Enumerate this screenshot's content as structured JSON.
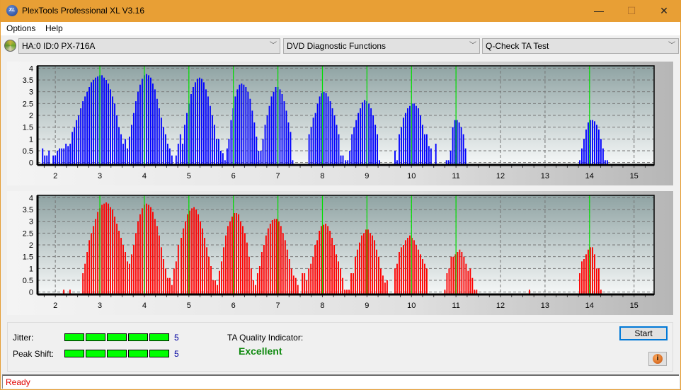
{
  "window": {
    "title": "PlexTools Professional XL V3.16",
    "logo_text": "XL",
    "controls": {
      "minimize": "—",
      "maximize": "☐",
      "close": "✕"
    }
  },
  "menu": {
    "items": [
      "Options",
      "Help"
    ]
  },
  "toolbar": {
    "drive": "HA:0 ID:0  PX-716A",
    "function_group": "DVD Diagnostic Functions",
    "test": "Q-Check TA Test",
    "chevron": "﹀"
  },
  "colors": {
    "blue_series": "#0000ff",
    "red_series": "#ff0000",
    "marker_line": "#00e000",
    "meter_fill": "#00ff00",
    "quality_text": "#108a10",
    "status_text": "#e00000"
  },
  "chart_data": [
    {
      "type": "bar",
      "title": "",
      "series_name": "TA land/pit distribution (top)",
      "color": "#0000ff",
      "xlabel": "",
      "ylabel": "",
      "xlim": [
        1.6,
        15.45
      ],
      "ylim": [
        -0.1,
        4.1
      ],
      "x_ticks": [
        2,
        3,
        4,
        5,
        6,
        7,
        8,
        9,
        10,
        11,
        12,
        13,
        14,
        15
      ],
      "y_ticks": [
        0,
        0.5,
        1,
        1.5,
        2,
        2.5,
        3,
        3.5,
        4
      ],
      "y_tick_labels": [
        "0",
        "0.5",
        "1",
        "1.5",
        "2",
        "2.5",
        "3",
        "3.5",
        "4"
      ],
      "reference_lines": [
        3,
        4,
        5,
        6,
        7,
        8,
        9,
        10,
        11,
        14
      ],
      "grid": true,
      "bar_step": 0.0476,
      "clusters": [
        {
          "start": 1.62,
          "values": [
            0,
            0,
            0.6,
            0.3,
            0.3,
            0.5,
            0,
            0.3,
            0.3,
            0.5,
            0.6,
            0.6,
            0.6,
            0.8,
            0.7,
            0.8,
            1.3,
            1.5,
            1.8,
            2.0,
            2.3,
            2.6,
            2.8,
            3.0,
            3.2,
            3.4,
            3.5,
            3.6,
            3.65,
            3.7,
            3.7,
            3.6,
            3.5,
            3.35,
            3.1,
            2.8,
            2.5,
            2.0,
            1.5,
            1.2,
            0.8,
            1.0,
            0.6,
            1.1,
            1.6,
            2.1,
            2.6,
            3.0,
            3.3,
            3.55,
            3.7,
            3.75,
            3.7,
            3.6,
            3.35,
            3.1,
            2.7,
            2.3,
            1.9,
            1.5,
            1.2,
            0.8,
            0.6,
            0.3,
            0,
            0.3,
            0.8,
            1.2
          ]
        },
        {
          "start": 4.86,
          "values": [
            0.8,
            1.6,
            2.1,
            2.5,
            2.9,
            3.2,
            3.4,
            3.55,
            3.6,
            3.55,
            3.4,
            3.1,
            2.8,
            2.4,
            2.0,
            1.6,
            1.0,
            1.0,
            0.5,
            0.4,
            0.1,
            0.6
          ]
        },
        {
          "start": 5.9,
          "values": [
            1.0,
            1.8,
            2.3,
            2.8,
            3.1,
            3.3,
            3.35,
            3.3,
            3.2,
            3.0,
            2.7,
            2.2,
            1.7,
            1.1,
            0.5
          ]
        },
        {
          "start": 6.57,
          "values": [
            0.1,
            0.5,
            1.0,
            1.6,
            2.0,
            2.4,
            2.8,
            3.0,
            3.2,
            3.2,
            3.1,
            2.9,
            2.6,
            2.2,
            1.7,
            1.3,
            0.1
          ]
        },
        {
          "start": 7.7,
          "values": [
            1.2,
            1.5,
            1.9,
            2.1,
            2.5,
            2.8,
            2.95,
            3.0,
            2.95,
            2.8,
            2.6,
            2.3,
            2.0,
            1.6,
            1.2,
            0.3,
            0.3
          ]
        },
        {
          "start": 8.52,
          "values": [
            0.1,
            0.1,
            0.5,
            1.2,
            1.5,
            1.8,
            2.1,
            2.3,
            2.55,
            2.65,
            2.6,
            2.5,
            2.3,
            2.0,
            1.6,
            1.2,
            0.1
          ]
        },
        {
          "start": 9.63,
          "values": [
            0.5,
            0.1,
            1.2,
            1.5,
            1.9,
            2.1,
            2.3,
            2.4,
            2.5,
            2.5,
            2.4,
            2.3,
            2.0,
            1.6,
            1.2,
            1.2,
            0.7,
            0.6
          ]
        },
        {
          "start": 10.5,
          "values": [
            0,
            0.8,
            0,
            0,
            0,
            0,
            0.1,
            0.1,
            0.5,
            1.5,
            1.8,
            1.8,
            1.7,
            1.5,
            1.2,
            0.6
          ]
        },
        {
          "start": 13.78,
          "values": [
            0.1,
            0.6,
            1.0,
            1.4,
            1.7,
            1.8,
            1.8,
            1.75,
            1.6,
            1.4,
            1.0,
            0.6,
            0.1,
            0.1
          ]
        }
      ]
    },
    {
      "type": "bar",
      "title": "",
      "series_name": "TA land/pit distribution (bottom)",
      "color": "#ff0000",
      "xlabel": "",
      "ylabel": "",
      "xlim": [
        1.6,
        15.45
      ],
      "ylim": [
        -0.1,
        4.1
      ],
      "x_ticks": [
        2,
        3,
        4,
        5,
        6,
        7,
        8,
        9,
        10,
        11,
        12,
        13,
        14,
        15
      ],
      "y_ticks": [
        0,
        0.5,
        1,
        1.5,
        2,
        2.5,
        3,
        3.5,
        4
      ],
      "y_tick_labels": [
        "0",
        "0.5",
        "1",
        "1.5",
        "2",
        "2.5",
        "3",
        "3.5",
        "4"
      ],
      "reference_lines": [
        3,
        4,
        5,
        6,
        7,
        8,
        9,
        10,
        11,
        14
      ],
      "grid": true,
      "bar_step": 0.0476,
      "clusters": [
        {
          "start": 2.19,
          "values": [
            0.1
          ]
        },
        {
          "start": 2.33,
          "values": [
            0.1
          ]
        },
        {
          "start": 2.62,
          "values": [
            0.8,
            1.2,
            1.7,
            2.2,
            2.5,
            2.8,
            3.1,
            3.4,
            3.55,
            3.7,
            3.75,
            3.8,
            3.75,
            3.6,
            3.5,
            3.2,
            2.9,
            2.6,
            2.3,
            2.0,
            1.7,
            1.3,
            1.2,
            1.6,
            2.0,
            2.5,
            3.0,
            3.3,
            3.55,
            3.7,
            3.75,
            3.7,
            3.6,
            3.4,
            3.1,
            2.8,
            2.4,
            1.9,
            1.4,
            1.0,
            0.6,
            0.6,
            0.3,
            1.0,
            1.3,
            2.0
          ]
        },
        {
          "start": 4.83,
          "values": [
            2.3,
            2.7,
            3.0,
            3.3,
            3.45,
            3.55,
            3.6,
            3.5,
            3.3,
            3.0,
            2.7,
            2.3,
            1.9,
            1.5,
            1.1,
            0.5,
            0.5,
            0.3,
            0.9,
            1.3,
            1.9,
            2.4,
            2.8,
            3.0,
            3.2,
            3.35,
            3.35,
            3.3,
            3.0,
            2.8,
            2.5,
            2.1,
            1.5,
            1.0,
            0.5,
            0.3,
            0.8,
            1.1,
            1.7,
            2.0,
            2.4,
            2.7,
            2.9,
            3.05,
            3.1,
            3.1,
            3.0,
            2.8,
            2.5,
            2.2,
            1.8,
            1.4,
            1.0,
            0.7,
            0.6,
            0.3
          ]
        },
        {
          "start": 7.55,
          "values": [
            0.8,
            0.8,
            0.5,
            1.0,
            1.2,
            1.5,
            2.0,
            2.2,
            2.6,
            2.8,
            2.85,
            2.9,
            2.8,
            2.6,
            2.3,
            2.0,
            1.6,
            1.3,
            1.0,
            0.6,
            0.1,
            0.1,
            0.1,
            0.8,
            0.8,
            1.5,
            1.8,
            2.1,
            2.4,
            2.5,
            2.65,
            2.65,
            2.5,
            2.4,
            2.2,
            1.8,
            1.5,
            1.0,
            0.7,
            0.4,
            0.5
          ]
        },
        {
          "start": 9.63,
          "values": [
            1.0,
            1.2,
            1.7,
            1.9,
            2.0,
            2.2,
            2.3,
            2.4,
            2.3,
            2.2,
            2.0,
            1.8,
            1.6,
            1.4,
            1.2,
            1.0
          ]
        },
        {
          "start": 10.75,
          "values": [
            0.1,
            0.8,
            1.0,
            1.5,
            1.5,
            1.6,
            1.7,
            1.8,
            1.7,
            1.5,
            1.2,
            0.9,
            1.0,
            0.6,
            0.1,
            0.1
          ]
        },
        {
          "start": 12.65,
          "values": [
            0.1
          ]
        },
        {
          "start": 13.78,
          "values": [
            0.8,
            1.3,
            1.4,
            1.6,
            1.8,
            1.9,
            1.9,
            1.6,
            1.0,
            1.0,
            0.1
          ]
        }
      ]
    }
  ],
  "results": {
    "jitter_label": "Jitter:",
    "jitter_value": "5",
    "jitter_level": 5,
    "jitter_max": 5,
    "peak_shift_label": "Peak Shift:",
    "peak_shift_value": "5",
    "peak_shift_level": 5,
    "peak_shift_max": 5,
    "ta_quality_label": "TA Quality Indicator:",
    "ta_quality_value": "Excellent"
  },
  "buttons": {
    "start": "Start",
    "info_icon": "i"
  },
  "status": {
    "text": "Ready"
  }
}
